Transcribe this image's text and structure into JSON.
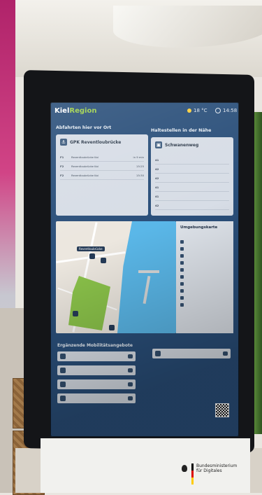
{
  "brand": {
    "part1": "Kiel",
    "part2": "Region"
  },
  "status": {
    "temperature": "18 °C",
    "time": "14:58"
  },
  "sections": {
    "departures_title": "Abfahrten hier vor Ort",
    "nearby_title": "Haltestellen in der Nähe",
    "mobility_title": "Ergänzende Mobilitätsangebote"
  },
  "departures": {
    "stop": "GPK Reventloubrücke",
    "rows": [
      {
        "line": "F1",
        "dest": "Reventloubrücke Kai",
        "time": "in 9 min"
      },
      {
        "line": "F2",
        "dest": "Reventloubrücke Kai",
        "time": "15:25"
      },
      {
        "line": "F2",
        "dest": "Reventloubrücke Kai",
        "time": "15:30"
      }
    ]
  },
  "nearby": {
    "stop": "Schwanenweg",
    "rows": [
      {
        "line": "41",
        "dest": "",
        "time": ""
      },
      {
        "line": "42",
        "dest": "",
        "time": ""
      },
      {
        "line": "42",
        "dest": "",
        "time": ""
      },
      {
        "line": "41",
        "dest": "",
        "time": ""
      },
      {
        "line": "41",
        "dest": "",
        "time": ""
      },
      {
        "line": "42",
        "dest": "",
        "time": ""
      }
    ]
  },
  "map": {
    "stop_chip": "Reventloubrücke",
    "legend_title": "Umgebungskarte"
  },
  "mobility": {
    "items": [
      {
        "name": "",
        "button": ""
      },
      {
        "name": "",
        "button": ""
      },
      {
        "name": "",
        "button": ""
      },
      {
        "name": "",
        "button": ""
      },
      {
        "name": "",
        "button": ""
      }
    ]
  },
  "sponsor": {
    "line1": "Bundesministerium",
    "line2": "für Digitales"
  }
}
